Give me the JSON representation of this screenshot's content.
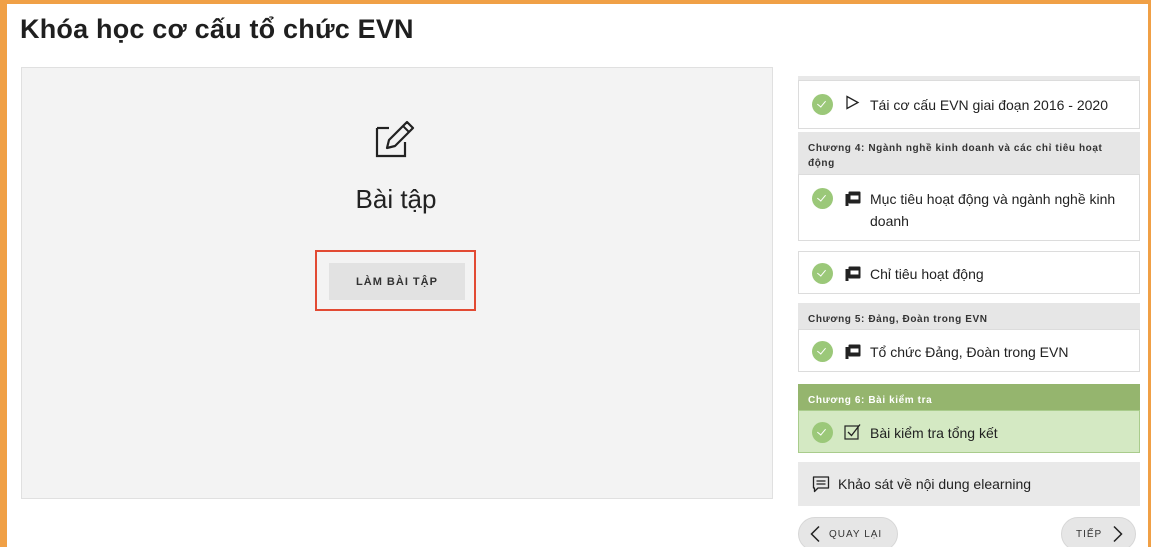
{
  "page": {
    "title": "Khóa học cơ cấu tổ chức EVN"
  },
  "content": {
    "heading": "Bài tập",
    "icon": "edit-icon",
    "action_label": "LÀM BÀI TẬP"
  },
  "outline": {
    "items": [
      {
        "type": "lesson",
        "icon": "play-icon",
        "label": "Tái cơ cấu EVN giai đoạn 2016 - 2020",
        "completed": true
      },
      {
        "type": "chapter",
        "label": "Chương 4: Ngành nghề kinh doanh và các chỉ tiêu hoạt động"
      },
      {
        "type": "lesson",
        "icon": "pdf-icon",
        "label_line1": "Mục tiêu hoạt động và ngành nghề kinh",
        "label_line2": "doanh",
        "completed": true
      },
      {
        "type": "lesson",
        "icon": "pdf-icon",
        "label": "Chỉ tiêu hoạt động",
        "completed": true
      },
      {
        "type": "chapter",
        "label": "Chương 5: Đảng, Đoàn trong EVN"
      },
      {
        "type": "lesson",
        "icon": "pdf-icon",
        "label": "Tổ chức Đảng, Đoàn trong EVN",
        "completed": true
      },
      {
        "type": "chapter",
        "label": "Chương 6: Bài kiểm tra",
        "active": true
      },
      {
        "type": "lesson",
        "icon": "checkbox-icon",
        "label": "Bài kiểm tra tổng kết",
        "completed": true,
        "active": true
      }
    ],
    "survey": {
      "icon": "comment-icon",
      "label": "Khảo sát về nội dung elearning"
    }
  },
  "navigation": {
    "back_label": "QUAY LẠI",
    "next_label": "TIẾP"
  },
  "colors": {
    "frame": "#f0a046",
    "completed": "#9bc879",
    "active_chapter": "#95b56e",
    "active_lesson": "#d4e9c3",
    "highlight": "#e24a33"
  }
}
